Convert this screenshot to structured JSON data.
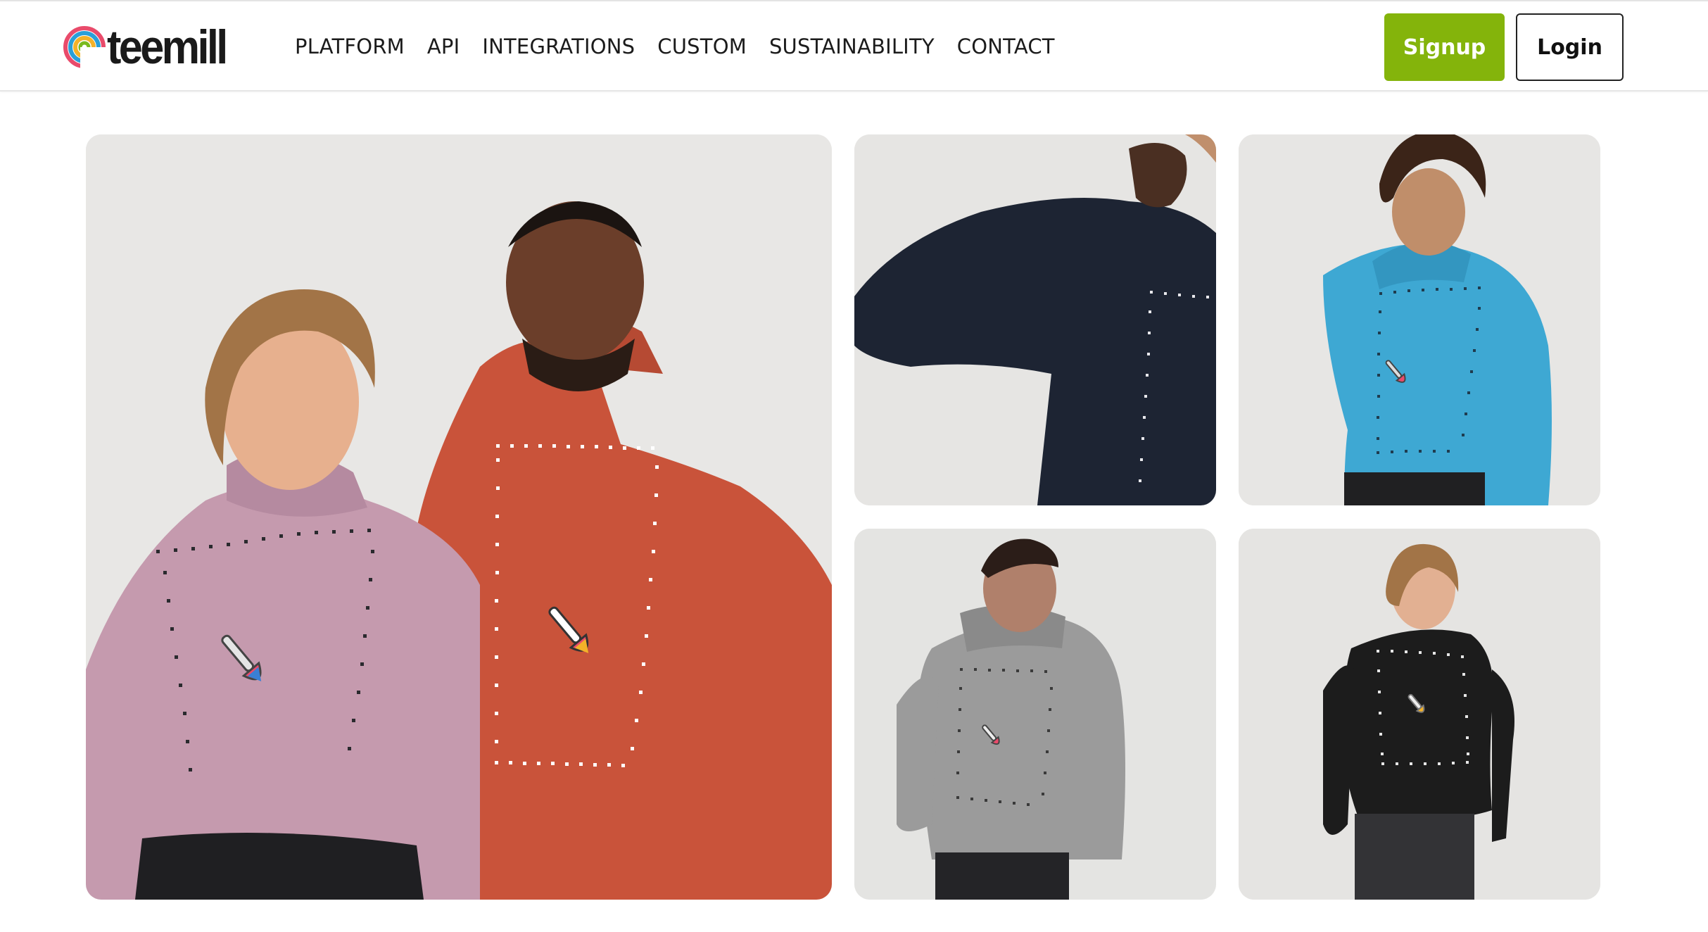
{
  "brand": {
    "name": "teemill",
    "accent": "#84b40b"
  },
  "nav": {
    "items": [
      {
        "label": "PLATFORM"
      },
      {
        "label": "API"
      },
      {
        "label": "INTEGRATIONS"
      },
      {
        "label": "CUSTOM"
      },
      {
        "label": "SUSTAINABILITY"
      },
      {
        "label": "CONTACT"
      }
    ],
    "signup_label": "Signup",
    "login_label": "Login"
  },
  "gallery": {
    "images": [
      {
        "name": "hero-pink-and-orange-hoodies",
        "hoodie_colors": [
          "#c59aae",
          "#c9533a"
        ]
      },
      {
        "name": "navy-hoodie-closeup",
        "hoodie_colors": [
          "#1d2433"
        ]
      },
      {
        "name": "blue-hoodie-model",
        "hoodie_colors": [
          "#3ea8d3"
        ]
      },
      {
        "name": "grey-hoodie-model",
        "hoodie_colors": [
          "#9b9b9b"
        ]
      },
      {
        "name": "black-hoodie-model",
        "hoodie_colors": [
          "#1c1c1c"
        ]
      }
    ],
    "print_area_icon": "paintbrush-icon"
  }
}
